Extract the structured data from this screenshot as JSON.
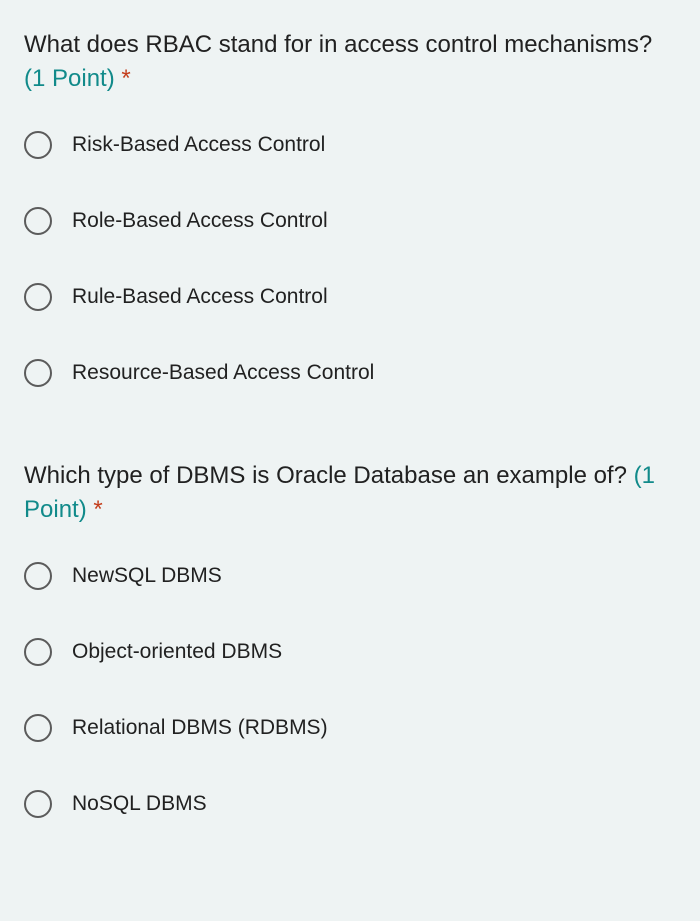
{
  "questions": [
    {
      "prompt": "What does RBAC stand for in access control mechanisms?",
      "points_label": "(1 Point)",
      "required_mark": "*",
      "options": [
        "Risk-Based Access Control",
        "Role-Based Access Control",
        "Rule-Based Access Control",
        "Resource-Based Access Control"
      ]
    },
    {
      "prompt": "Which type of DBMS is Oracle Database an example of?",
      "points_label": "(1 Point)",
      "required_mark": "*",
      "options": [
        "NewSQL DBMS",
        "Object-oriented DBMS",
        "Relational DBMS (RDBMS)",
        "NoSQL DBMS"
      ]
    }
  ]
}
